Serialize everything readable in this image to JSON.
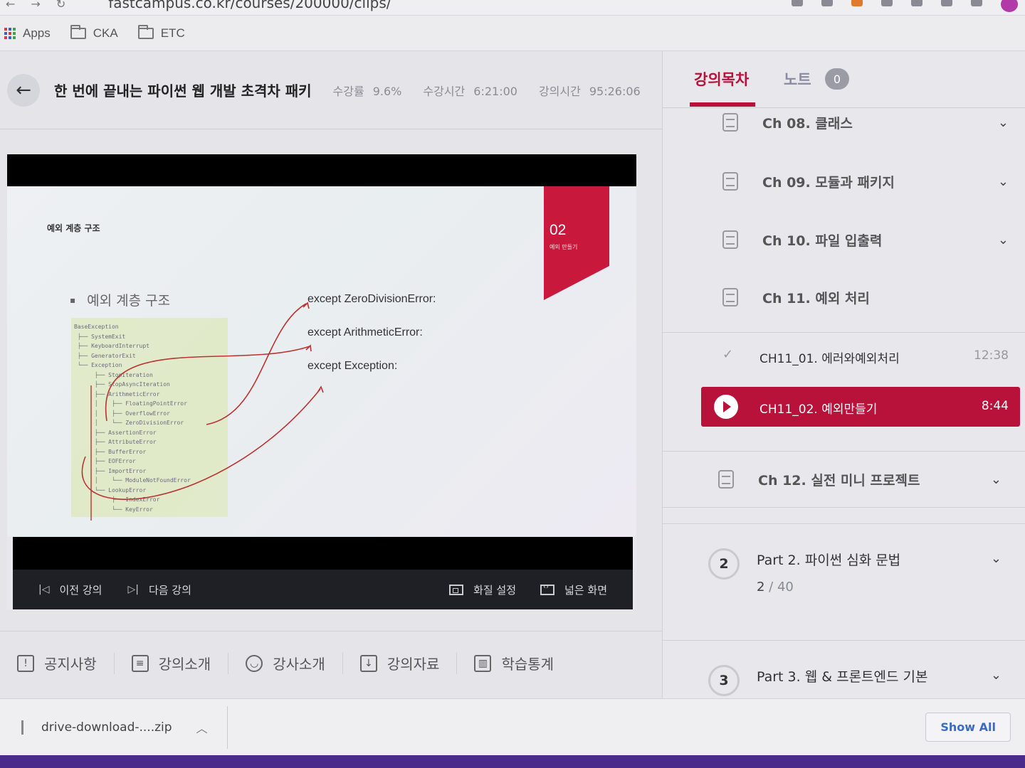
{
  "browser": {
    "url": "fastcampus.co.kr/courses/200000/clips/"
  },
  "bookmarks": [
    {
      "label": "Apps"
    },
    {
      "label": "CKA"
    },
    {
      "label": "ETC"
    }
  ],
  "course": {
    "title": "한 번에 끝내는 파이썬 웹 개발 초격차 패키",
    "stats": [
      {
        "label": "수강률",
        "value": "9.6%"
      },
      {
        "label": "수강시간",
        "value": "6:21:00"
      },
      {
        "label": "강의시간",
        "value": "95:26:06"
      }
    ]
  },
  "slide": {
    "header": "예외 계층 구조",
    "bullet": "예외 계층 구조",
    "ribbon_number": "02",
    "ribbon_sub": "예외 만들기",
    "hierarchy": "BaseException\n ├── SystemExit\n ├── KeyboardInterrupt\n ├── GeneratorExit\n └── Exception\n      ├── StopIteration\n      ├── StopAsyncIteration\n      ├── ArithmeticError\n      │    ├── FloatingPointError\n      │    ├── OverflowError\n      │    └── ZeroDivisionError\n      ├── AssertionError\n      ├── AttributeError\n      ├── BufferError\n      ├── EOFError\n      ├── ImportError\n      │    └── ModuleNotFoundError\n      └── LookupError\n           ├── IndexError\n           └── KeyError",
    "code_lines": [
      "except ZeroDivisionError:",
      "except ArithmeticError:",
      "except Exception:"
    ]
  },
  "player_controls": {
    "prev": "이전 강의",
    "next": "다음 강의",
    "quality": "화질 설정",
    "wide": "넓은 화면"
  },
  "course_tabs": [
    {
      "label": "공지사항",
      "icon": "notice-icon"
    },
    {
      "label": "강의소개",
      "icon": "clipboard-icon"
    },
    {
      "label": "강사소개",
      "icon": "user-icon"
    },
    {
      "label": "강의자료",
      "icon": "download-icon"
    },
    {
      "label": "학습통계",
      "icon": "chart-icon"
    }
  ],
  "sidebar": {
    "tab_toc": "강의목차",
    "tab_notes": "노트",
    "notes_count": "0",
    "chapters": [
      {
        "label": "Ch 08. 클래스"
      },
      {
        "label": "Ch 09. 모듈과 패키지"
      },
      {
        "label": "Ch 10. 파일 입출력"
      },
      {
        "label": "Ch 11. 예외 처리"
      }
    ],
    "lectures": [
      {
        "label": "CH11_01. 에러와예외처리",
        "duration": "12:38"
      },
      {
        "label": "CH11_02. 예외만들기",
        "duration": "8:44"
      }
    ],
    "chapter_after": {
      "label": "Ch 12. 실전 미니 프로젝트"
    },
    "parts": [
      {
        "number": "2",
        "title": "Part 2. 파이썬 심화 문법",
        "done": "2",
        "total": "40"
      },
      {
        "number": "3",
        "title": "Part 3. 웹 & 프론트엔드 기본",
        "done": "",
        "total": ""
      }
    ]
  },
  "downloads": {
    "file": "drive-download-....zip",
    "show_all": "Show All"
  },
  "colors": {
    "accent": "#b8123a",
    "player_bg": "#1f1f26"
  }
}
